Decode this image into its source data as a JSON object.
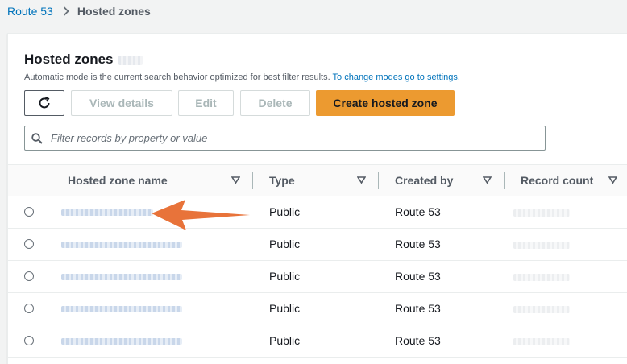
{
  "breadcrumb": {
    "parent": "Route 53",
    "current": "Hosted zones"
  },
  "panel": {
    "title": "Hosted zones",
    "description": "Automatic mode is the current search behavior optimized for best filter results.",
    "description_link": "To change modes go to settings."
  },
  "toolbar": {
    "view_details": "View details",
    "edit": "Edit",
    "delete": "Delete",
    "create": "Create hosted zone"
  },
  "filter": {
    "placeholder": "Filter records by property or value"
  },
  "table": {
    "columns": [
      "Hosted zone name",
      "Type",
      "Created by",
      "Record count"
    ],
    "rows": [
      {
        "type": "Public",
        "created_by": "Route 53"
      },
      {
        "type": "Public",
        "created_by": "Route 53"
      },
      {
        "type": "Public",
        "created_by": "Route 53"
      },
      {
        "type": "Public",
        "created_by": "Route 53"
      },
      {
        "type": "Public",
        "created_by": "Route 53"
      }
    ]
  },
  "colors": {
    "primary_button": "#ec9a30",
    "link": "#0073bb",
    "annotation_arrow": "#e8733a"
  }
}
